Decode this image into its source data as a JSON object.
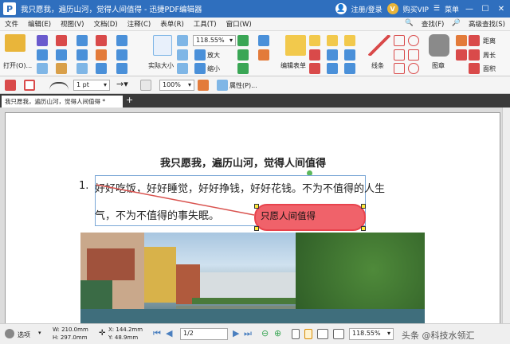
{
  "window": {
    "title": "我只愿我，遍历山河，觉得人间值得 - 迅捷PDF编辑器",
    "app_icon": "P",
    "login": "注册/登录",
    "buy_vip": "购买VIP",
    "menu": "菜单",
    "vip_badge": "V"
  },
  "menu": {
    "items": [
      "文件",
      "编辑(E)",
      "视图(V)",
      "文档(D)",
      "注释(C)",
      "表单(R)",
      "工具(T)",
      "窗口(W)"
    ],
    "find": "查找(F)",
    "adv_find": "高级查找(S)"
  },
  "ribbon": {
    "open_label": "打开(O)...",
    "actual_size": "实际大小",
    "zoom_value": "118.55%",
    "zoom_in": "放大",
    "zoom_out": "缩小",
    "edit_form": "编辑表单",
    "line": "线条",
    "chart": "图章",
    "distance": "距离",
    "perimeter": "周长",
    "area": "面积"
  },
  "format": {
    "line_width": "1 pt",
    "opacity": "100%",
    "properties": "属性(P)..."
  },
  "tabs": {
    "doc_tab": "我只愿我，遍历山河，觉得人间值得 *",
    "add": "+"
  },
  "document": {
    "title": "我只愿我，遍历山河，觉得人间值得",
    "list_number": "1.",
    "line1": "好好吃饭，好好睡觉，好好挣钱，好好花钱。不为不值得的人生",
    "line2": "气，不为不值得的事失眠。",
    "callout": "只愿人间值得"
  },
  "status": {
    "select_label": "选项",
    "width": "W: 210.0mm",
    "height": "H: 297.0mm",
    "x": "X: 144.2mm",
    "y": "Y: 48.9mm",
    "page": "1/2",
    "zoom": "118.55%",
    "watermark": "头条 @科技水领汇"
  }
}
